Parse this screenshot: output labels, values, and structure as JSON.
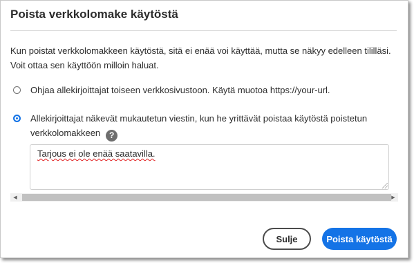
{
  "dialog": {
    "title": "Poista verkkolomake käytöstä",
    "description": "Kun poistat verkkolomakkeen käytöstä, sitä ei enää voi käyttää, mutta se näkyy edelleen tililläsi. Voit ottaa sen käyttöön milloin haluat."
  },
  "options": [
    {
      "label": "Ohjaa allekirjoittajat toiseen verkkosivustoon. Käytä muotoa https://your-url.",
      "selected": false
    },
    {
      "label": "Allekirjoittajat näkevät mukautetun viestin, kun he yrittävät poistaa käytöstä poistetun verkkolomakkeen",
      "selected": true,
      "help_icon": "question-circle-icon"
    }
  ],
  "message_field": {
    "value": "Tarjous ei ole enää saatavilla."
  },
  "scrollbar": {
    "left_arrow": "◀",
    "right_arrow": "▶"
  },
  "help_glyph": "?",
  "buttons": {
    "close_label": "Sulje",
    "primary_label": "Poista käytöstä"
  },
  "colors": {
    "accent": "#1473e6",
    "text": "#2c2c2c",
    "spellcheck": "#e02020"
  }
}
